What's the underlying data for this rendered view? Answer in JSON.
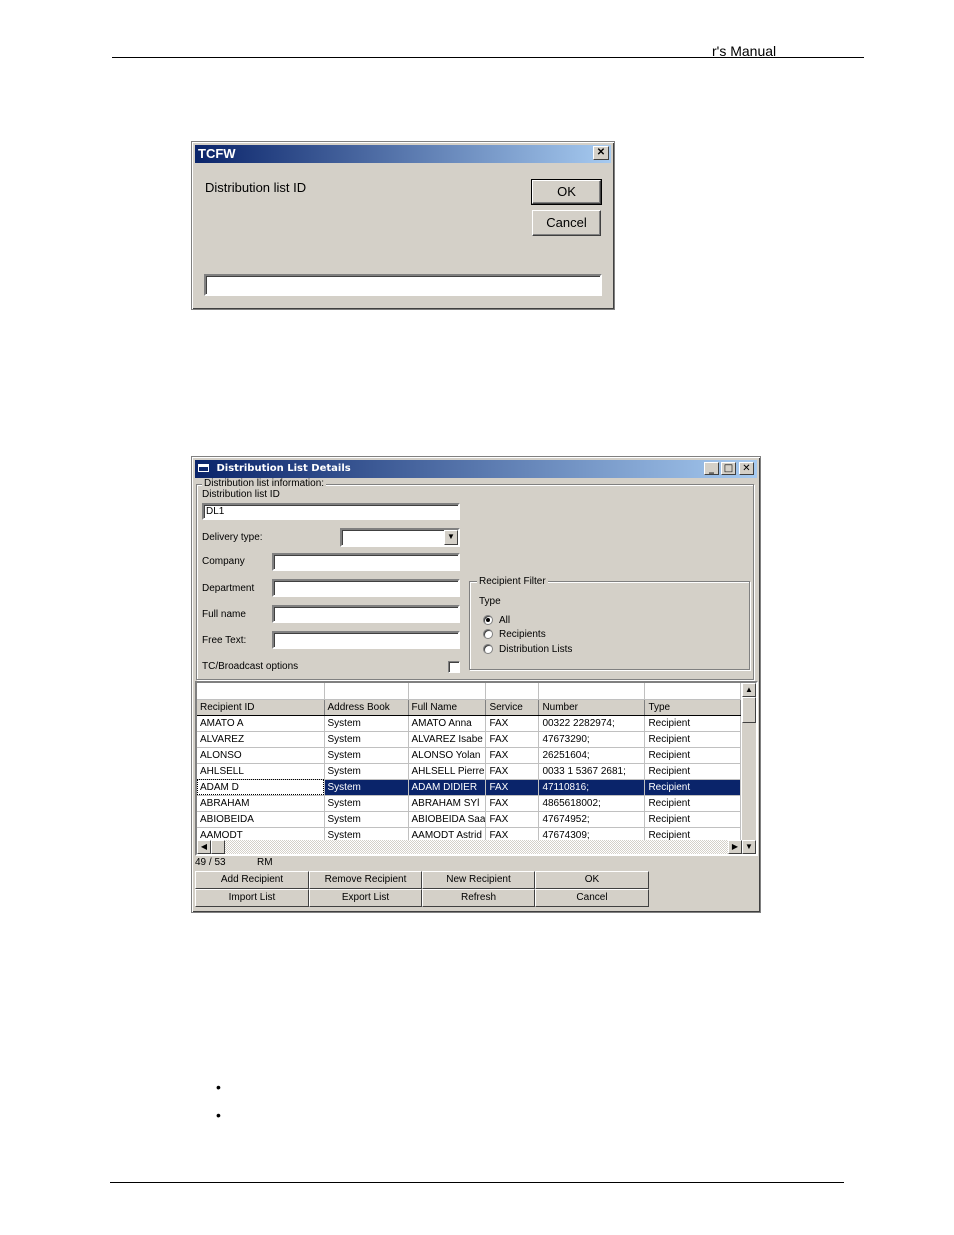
{
  "document": {
    "header_text": "r's Manual",
    "bullets": [
      "",
      ""
    ]
  },
  "dialog_small": {
    "title": "TCFW",
    "prompt": "Distribution list ID",
    "ok_label": "OK",
    "cancel_label": "Cancel",
    "input_value": "",
    "close_glyph": "✕"
  },
  "dialog_details": {
    "title": "Distribution List Details",
    "icons": {
      "app": "window-icon",
      "minimize": "_",
      "maximize": "□",
      "close": "✕"
    },
    "info_group_title": "Distribution list information:",
    "fields": {
      "list_id_label": "Distribution list ID",
      "list_id_value": "DL1",
      "delivery_type_label": "Delivery type:",
      "delivery_type_value": "",
      "company_label": "Company",
      "company_value": "",
      "department_label": "Department",
      "department_value": "",
      "full_name_label": "Full name",
      "full_name_value": "",
      "free_text_label": "Free Text:",
      "free_text_value": "",
      "broadcast_label": "TC/Broadcast options",
      "broadcast_checked": false
    },
    "filter": {
      "title": "Recipient Filter",
      "type_label": "Type",
      "options": [
        {
          "label": "All",
          "selected": true
        },
        {
          "label": "Recipients",
          "selected": false
        },
        {
          "label": "Distribution Lists",
          "selected": false
        }
      ]
    },
    "table": {
      "columns": [
        "Recipient ID",
        "Address Book",
        "Full Name",
        "Service",
        "Number",
        "Type"
      ],
      "rows": [
        [
          "AMATO A",
          "System",
          "AMATO Anna",
          "FAX",
          "00322 2282974;",
          "Recipient"
        ],
        [
          "ALVAREZ",
          "System",
          "ALVAREZ Isabe",
          "FAX",
          "47673290;",
          "Recipient"
        ],
        [
          "ALONSO",
          "System",
          "ALONSO Yolan",
          "FAX",
          "26251604;",
          "Recipient"
        ],
        [
          "AHLSELL",
          "System",
          "AHLSELL Pierre",
          "FAX",
          "0033 1 5367 2681;",
          "Recipient"
        ],
        [
          "ADAM D",
          "System",
          "ADAM  DIDIER",
          "FAX",
          "47110816;",
          "Recipient"
        ],
        [
          "ABRAHAM",
          "System",
          "ABRAHAM  SYl",
          "FAX",
          "4865618002;",
          "Recipient"
        ],
        [
          "ABIOBEIDA",
          "System",
          "ABIOBEIDA Saa",
          "FAX",
          "47674952;",
          "Recipient"
        ],
        [
          "AAMODT",
          "System",
          "AAMODT Astrid",
          "FAX",
          "47674309;",
          "Recipient"
        ]
      ],
      "selected_row": 4
    },
    "status": {
      "count": "49 / 53",
      "user": "RM"
    },
    "buttons": {
      "add_recipient": "Add Recipient",
      "remove_recipient": "Remove Recipient",
      "new_recipient": "New Recipient",
      "ok": "OK",
      "import_list": "Import List",
      "export_list": "Export List",
      "refresh": "Refresh",
      "cancel": "Cancel"
    }
  }
}
